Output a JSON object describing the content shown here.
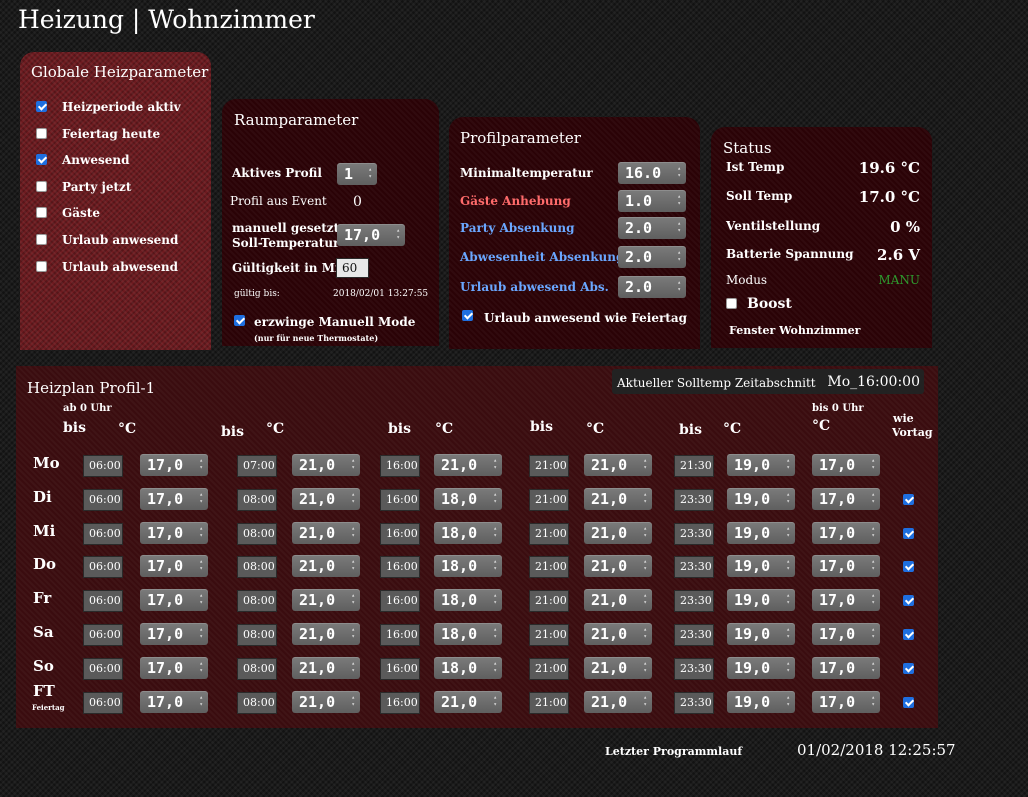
{
  "page_title": "Heizung | Wohnzimmer",
  "globale": {
    "title": "Globale Heizparameter",
    "items": [
      {
        "label": "Heizperiode aktiv",
        "checked": true
      },
      {
        "label": "Feiertag heute",
        "checked": false
      },
      {
        "label": "Anwesend",
        "checked": true
      },
      {
        "label": "Party jetzt",
        "checked": false
      },
      {
        "label": "Gäste",
        "checked": false
      },
      {
        "label": "Urlaub anwesend",
        "checked": false
      },
      {
        "label": "Urlaub abwesend",
        "checked": false
      }
    ]
  },
  "raum": {
    "title": "Raumparameter",
    "aktives_profil_label": "Aktives Profil",
    "aktives_profil_value": "1",
    "profil_event_label": "Profil aus Event",
    "profil_event_value": "0",
    "manuell_label_1": "manuell gesetzte",
    "manuell_label_2": "Soll-Temperatur",
    "manuell_value": "17,0",
    "gueltigkeit_label": "Gültigkeit in Min",
    "gueltigkeit_value": "60",
    "gueltig_bis_label": "gültig bis:",
    "gueltig_bis_value": "2018/02/01 13:27:55",
    "erzwinge_label": "erzwinge Manuell Mode",
    "erzwinge_checked": true,
    "erzwinge_note": "(nur für neue Thermostate)"
  },
  "profil": {
    "title": "Profilparameter",
    "rows": [
      {
        "label": "Minimaltemperatur",
        "value": "16.0",
        "color": "#ffffff"
      },
      {
        "label": "Gäste Anhebung",
        "value": "1.0",
        "color": "#ff6b6b"
      },
      {
        "label": "Party Absenkung",
        "value": "2.0",
        "color": "#6aa7ff"
      },
      {
        "label": "Abwesenheit Absenkung",
        "value": "2.0",
        "color": "#6aa7ff"
      },
      {
        "label": "Urlaub abwesend Abs.",
        "value": "2.0",
        "color": "#6aa7ff"
      }
    ],
    "feiertag_label": "Urlaub anwesend wie Feiertag",
    "feiertag_checked": true
  },
  "status": {
    "title": "Status",
    "ist_label": "Ist Temp",
    "ist_value": "19.6 °C",
    "soll_label": "Soll Temp",
    "soll_value": "17.0 °C",
    "ventil_label": "Ventilstellung",
    "ventil_value": "0 %",
    "batterie_label": "Batterie Spannung",
    "batterie_value": "2.6 V",
    "modus_label": "Modus",
    "modus_value": "MANU",
    "modus_color": "#2e9b2e",
    "boost_label": "Boost",
    "boost_checked": false,
    "fenster_label": "Fenster Wohnzimmer"
  },
  "heizplan": {
    "title": "Heizplan Profil-1",
    "zeitabschnitt_label": "Aktueller Solltemp Zeitabschnitt",
    "zeitabschnitt_value": "Mo_16:00:00",
    "headers": {
      "ab0": "ab 0 Uhr",
      "bis": "bis",
      "c": "°C",
      "bis0": "bis 0 Uhr",
      "wie": "wie",
      "vortag": "Vortag"
    },
    "feiertag_sub": "Feiertag",
    "days": [
      {
        "name": "Mo",
        "t": [
          "06:00",
          "07:00",
          "16:00",
          "21:00",
          "21:30"
        ],
        "v": [
          "17,0",
          "21,0",
          "21,0",
          "21,0",
          "19,0",
          "17,0"
        ],
        "wie": null
      },
      {
        "name": "Di",
        "t": [
          "06:00",
          "08:00",
          "16:00",
          "21:00",
          "23:30"
        ],
        "v": [
          "17,0",
          "21,0",
          "18,0",
          "21,0",
          "19,0",
          "17,0"
        ],
        "wie": true
      },
      {
        "name": "Mi",
        "t": [
          "06:00",
          "08:00",
          "16:00",
          "21:00",
          "23:30"
        ],
        "v": [
          "17,0",
          "21,0",
          "18,0",
          "21,0",
          "19,0",
          "17,0"
        ],
        "wie": true
      },
      {
        "name": "Do",
        "t": [
          "06:00",
          "08:00",
          "16:00",
          "21:00",
          "23:30"
        ],
        "v": [
          "17,0",
          "21,0",
          "18,0",
          "21,0",
          "19,0",
          "17,0"
        ],
        "wie": true
      },
      {
        "name": "Fr",
        "t": [
          "06:00",
          "08:00",
          "16:00",
          "21:00",
          "23:30"
        ],
        "v": [
          "17,0",
          "21,0",
          "18,0",
          "21,0",
          "19,0",
          "17,0"
        ],
        "wie": true
      },
      {
        "name": "Sa",
        "t": [
          "06:00",
          "08:00",
          "16:00",
          "21:00",
          "23:30"
        ],
        "v": [
          "17,0",
          "21,0",
          "18,0",
          "21,0",
          "19,0",
          "17,0"
        ],
        "wie": true
      },
      {
        "name": "So",
        "t": [
          "06:00",
          "08:00",
          "16:00",
          "21:00",
          "23:30"
        ],
        "v": [
          "17,0",
          "21,0",
          "18,0",
          "21,0",
          "19,0",
          "17,0"
        ],
        "wie": true
      },
      {
        "name": "FT",
        "t": [
          "06:00",
          "08:00",
          "16:00",
          "21:00",
          "23:30"
        ],
        "v": [
          "17,0",
          "21,0",
          "21,0",
          "21,0",
          "19,0",
          "17,0"
        ],
        "wie": true
      }
    ]
  },
  "footer": {
    "label": "Letzter Programmlauf",
    "value": "01/02/2018 12:25:57"
  }
}
